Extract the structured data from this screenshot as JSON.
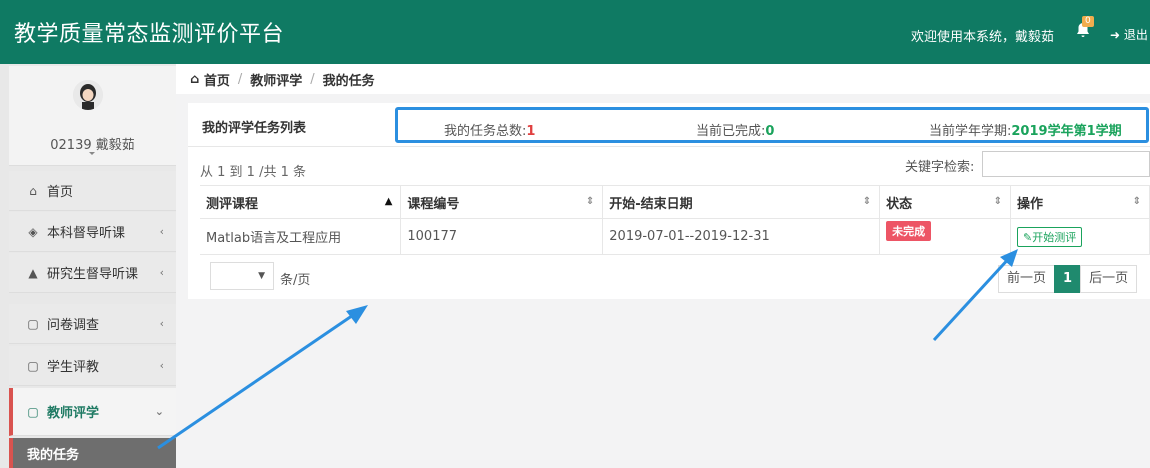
{
  "header": {
    "title": "教学质量常态监测评价平台",
    "welcome": "欢迎使用本系统，戴毅茹",
    "notification_count": "0",
    "logout": "退出",
    "bg_color": "#0f7a63"
  },
  "profile": {
    "user": "02139  戴毅茹"
  },
  "sidebar": {
    "items": [
      {
        "label": "首页",
        "icon": "home-icon"
      },
      {
        "label": "本科督导听课",
        "icon": "cube-icon"
      },
      {
        "label": "研究生督导听课",
        "icon": "graduation-cap-icon"
      },
      {
        "label": "问卷调查",
        "icon": "file-icon"
      },
      {
        "label": "学生评教",
        "icon": "file-icon"
      },
      {
        "label": "教师评学",
        "icon": "file-icon"
      }
    ],
    "sub_item": "我的任务"
  },
  "breadcrumb": {
    "home": "首页",
    "level1": "教师评学",
    "level2": "我的任务"
  },
  "panel": {
    "title": "我的评学任务列表",
    "total_label": "我的任务总数:",
    "total_value": "1",
    "done_label": "当前已完成:",
    "done_value": "0",
    "term_label": "当前学年学期:",
    "term_value": "2019学年第1学期"
  },
  "table": {
    "info": "从 1 到 1 /共 1 条",
    "search_label": "关键字检索:",
    "search_value": "",
    "headers": [
      "测评课程",
      "课程编号",
      "开始-结束日期",
      "状态",
      "操作"
    ],
    "rows": [
      {
        "course": "Matlab语言及工程应用",
        "code": "100177",
        "dates": "2019-07-01--2019-12-31",
        "status": "未完成",
        "action": "开始测评"
      }
    ],
    "perpage_value": "",
    "perpage_label": "条/页",
    "pager": {
      "prev": "前一页",
      "current": "1",
      "next": "后一页"
    }
  }
}
